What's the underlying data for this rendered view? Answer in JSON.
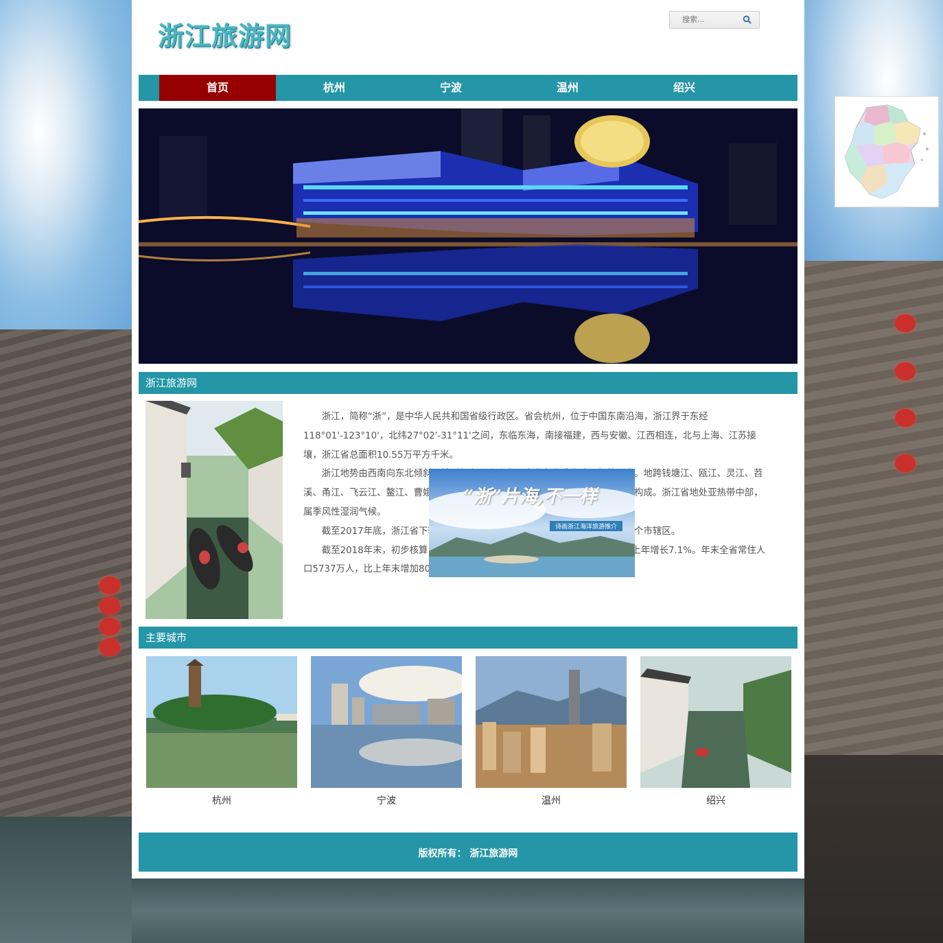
{
  "site": {
    "logo": "浙江旅游网"
  },
  "search": {
    "placeholder": "搜索..."
  },
  "nav": {
    "items": [
      {
        "label": "首页"
      },
      {
        "label": "杭州"
      },
      {
        "label": "宁波"
      },
      {
        "label": "温州"
      },
      {
        "label": "绍兴"
      }
    ]
  },
  "intro": {
    "title": "浙江旅游网",
    "paragraphs": [
      "浙江，简称“浙”，是中华人民共和国省级行政区。省会杭州，位于中国东南沿海，浙江界于东经118°01'-123°10'，北纬27°02'-31°11'之间，东临东海，南接福建，西与安徽、江西相连，北与上海、江苏接壤，浙江省总面积10.55万平方千米。",
      "浙江地势由西南向东北倾斜，地形复杂。山脉自西南向东北成大致平行的三支。地跨钱塘江、瓯江、灵江、苕溪、甬江、飞云江、鳌江、曹娥江八大水系；浙江地形由山地、丘陵、盆地、岛屿构成。浙江省地处亚热带中部，属季风性湿润气候。",
      "截至2017年底，浙江省下辖11个地级市，其中2个副省级城市；53个县，37个市辖区。",
      "截至2018年末，初步核算，全省生产总值56197亿元，按可比价格计算，比上年增长7.1%。年末全省常住人口5737万人，比上年末增加80万人。"
    ]
  },
  "ad": {
    "headline": "“浙”片海,不一样",
    "subtitle": "诗画浙江海洋旅游推介"
  },
  "cities": {
    "title": "主要城市",
    "items": [
      {
        "name": "杭州"
      },
      {
        "name": "宁波"
      },
      {
        "name": "温州"
      },
      {
        "name": "绍兴"
      }
    ]
  },
  "footer": {
    "text": "版权所有： 浙江旅游网"
  },
  "colors": {
    "teal": "#2496a7",
    "active_nav": "#960000"
  }
}
